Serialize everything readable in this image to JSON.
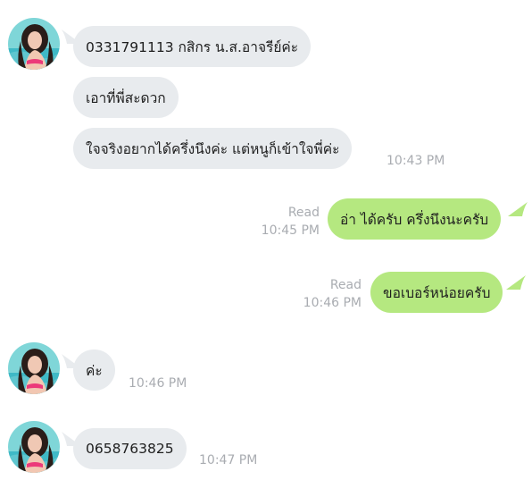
{
  "conversation": {
    "messages": [
      {
        "sender": "contact",
        "text": "0331791113 กสิกร น.ส.อาจรีย์ค่ะ",
        "time": ""
      },
      {
        "sender": "contact",
        "text": "เอาที่พี่สะดวก",
        "time": ""
      },
      {
        "sender": "contact",
        "text": "ใจจริงอยากได้ครึ่งนึงค่ะ แต่หนูก็เข้าใจพี่ค่ะ",
        "time": "10:43 PM"
      },
      {
        "sender": "me",
        "text": "อ่า ได้ครับ ครึ่งนึงนะครับ",
        "status": "Read",
        "time": "10:45 PM"
      },
      {
        "sender": "me",
        "text": "ขอเบอร์หน่อยครับ",
        "status": "Read",
        "time": "10:46 PM"
      },
      {
        "sender": "contact",
        "text": "ค่ะ",
        "time": "10:46 PM"
      },
      {
        "sender": "contact",
        "text": "0658763825",
        "time": "10:47 PM"
      }
    ]
  },
  "colors": {
    "incoming_bubble": "#e8ebee",
    "outgoing_bubble": "#b5e880",
    "timestamp": "#a9acb1"
  },
  "icons": {
    "contact_avatar": "avatar"
  }
}
